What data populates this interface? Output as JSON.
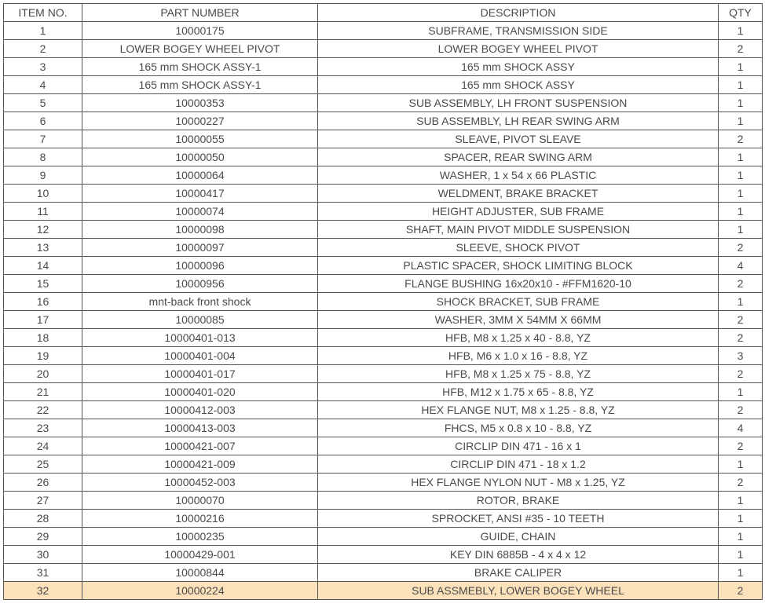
{
  "chart_data": {
    "type": "table",
    "columns": [
      "ITEM NO.",
      "PART NUMBER",
      "DESCRIPTION",
      "QTY"
    ],
    "rows": [
      {
        "item_no": "1",
        "part_number": "10000175",
        "description": "SUBFRAME, TRANSMISSION SIDE",
        "qty": "1",
        "highlight": false
      },
      {
        "item_no": "2",
        "part_number": "LOWER BOGEY WHEEL PIVOT",
        "description": "LOWER BOGEY WHEEL PIVOT",
        "qty": "2",
        "highlight": false
      },
      {
        "item_no": "3",
        "part_number": "165 mm SHOCK ASSY-1",
        "description": "165 mm SHOCK ASSY",
        "qty": "1",
        "highlight": false
      },
      {
        "item_no": "4",
        "part_number": "165 mm SHOCK ASSY-1",
        "description": "165 mm SHOCK ASSY",
        "qty": "1",
        "highlight": false
      },
      {
        "item_no": "5",
        "part_number": "10000353",
        "description": "SUB ASSEMBLY, LH FRONT SUSPENSION",
        "qty": "1",
        "highlight": false
      },
      {
        "item_no": "6",
        "part_number": "10000227",
        "description": "SUB ASSEMBLY, LH REAR SWING ARM",
        "qty": "1",
        "highlight": false
      },
      {
        "item_no": "7",
        "part_number": "10000055",
        "description": "SLEAVE, PIVOT SLEAVE",
        "qty": "2",
        "highlight": false
      },
      {
        "item_no": "8",
        "part_number": "10000050",
        "description": "SPACER, REAR SWING ARM",
        "qty": "1",
        "highlight": false
      },
      {
        "item_no": "9",
        "part_number": "10000064",
        "description": "WASHER, 1 x 54 x 66 PLASTIC",
        "qty": "1",
        "highlight": false
      },
      {
        "item_no": "10",
        "part_number": "10000417",
        "description": "WELDMENT, BRAKE BRACKET",
        "qty": "1",
        "highlight": false
      },
      {
        "item_no": "11",
        "part_number": "10000074",
        "description": "HEIGHT ADJUSTER, SUB FRAME",
        "qty": "1",
        "highlight": false
      },
      {
        "item_no": "12",
        "part_number": "10000098",
        "description": "SHAFT, MAIN PIVOT MIDDLE SUSPENSION",
        "qty": "1",
        "highlight": false
      },
      {
        "item_no": "13",
        "part_number": "10000097",
        "description": "SLEEVE, SHOCK PIVOT",
        "qty": "2",
        "highlight": false
      },
      {
        "item_no": "14",
        "part_number": "10000096",
        "description": "PLASTIC SPACER, SHOCK LIMITING BLOCK",
        "qty": "4",
        "highlight": false
      },
      {
        "item_no": "15",
        "part_number": "10000956",
        "description": "FLANGE BUSHING 16x20x10 - #FFM1620-10",
        "qty": "2",
        "highlight": false
      },
      {
        "item_no": "16",
        "part_number": "mnt-back front shock",
        "description": "SHOCK BRACKET, SUB FRAME",
        "qty": "1",
        "highlight": false
      },
      {
        "item_no": "17",
        "part_number": "10000085",
        "description": "WASHER, 3MM X 54MM X 66MM",
        "qty": "2",
        "highlight": false
      },
      {
        "item_no": "18",
        "part_number": "10000401-013",
        "description": "HFB, M8 x 1.25 x 40 - 8.8, YZ",
        "qty": "2",
        "highlight": false
      },
      {
        "item_no": "19",
        "part_number": "10000401-004",
        "description": "HFB, M6 x 1.0 x 16 - 8.8, YZ",
        "qty": "3",
        "highlight": false
      },
      {
        "item_no": "20",
        "part_number": "10000401-017",
        "description": "HFB, M8 x 1.25 x 75 - 8.8, YZ",
        "qty": "2",
        "highlight": false
      },
      {
        "item_no": "21",
        "part_number": "10000401-020",
        "description": "HFB, M12 x 1.75 x 65 - 8.8, YZ",
        "qty": "1",
        "highlight": false
      },
      {
        "item_no": "22",
        "part_number": "10000412-003",
        "description": "HEX FLANGE NUT, M8 x 1.25 - 8.8, YZ",
        "qty": "2",
        "highlight": false
      },
      {
        "item_no": "23",
        "part_number": "10000413-003",
        "description": "FHCS, M5 x 0.8 x 10 - 8.8, YZ",
        "qty": "4",
        "highlight": false
      },
      {
        "item_no": "24",
        "part_number": "10000421-007",
        "description": "CIRCLIP DIN 471 - 16 x 1",
        "qty": "2",
        "highlight": false
      },
      {
        "item_no": "25",
        "part_number": "10000421-009",
        "description": "CIRCLIP DIN 471 - 18 x 1.2",
        "qty": "1",
        "highlight": false
      },
      {
        "item_no": "26",
        "part_number": "10000452-003",
        "description": "HEX FLANGE NYLON NUT - M8 x 1.25, YZ",
        "qty": "2",
        "highlight": false
      },
      {
        "item_no": "27",
        "part_number": "10000070",
        "description": "ROTOR, BRAKE",
        "qty": "1",
        "highlight": false
      },
      {
        "item_no": "28",
        "part_number": "10000216",
        "description": "SPROCKET, ANSI #35 - 10 TEETH",
        "qty": "1",
        "highlight": false
      },
      {
        "item_no": "29",
        "part_number": "10000235",
        "description": "GUIDE, CHAIN",
        "qty": "1",
        "highlight": false
      },
      {
        "item_no": "30",
        "part_number": "10000429-001",
        "description": "KEY DIN 6885B - 4 x 4 x 12",
        "qty": "1",
        "highlight": false
      },
      {
        "item_no": "31",
        "part_number": "10000844",
        "description": "BRAKE CALIPER",
        "qty": "1",
        "highlight": false
      },
      {
        "item_no": "32",
        "part_number": "10000224",
        "description": "SUB ASSMEBLY, LOWER BOGEY WHEEL",
        "qty": "2",
        "highlight": true
      }
    ]
  }
}
